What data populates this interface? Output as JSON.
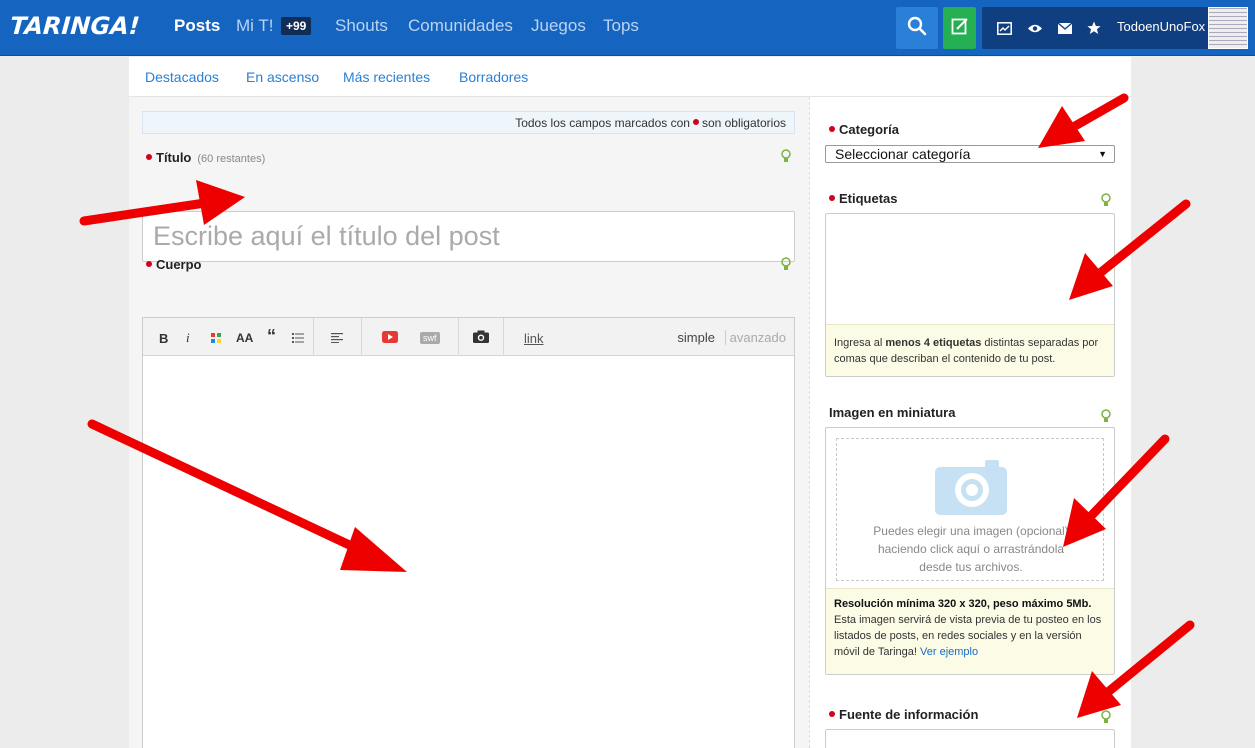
{
  "brand": {
    "logo": "TARINGA!"
  },
  "nav": {
    "items": [
      {
        "label": "Posts"
      },
      {
        "label": "Mi T!"
      },
      {
        "label": "Shouts"
      },
      {
        "label": "Comunidades"
      },
      {
        "label": "Juegos"
      },
      {
        "label": "Tops"
      }
    ],
    "badge": "+99"
  },
  "user": {
    "name": "TodoenUnoFox"
  },
  "subnav": {
    "items": [
      {
        "label": "Destacados"
      },
      {
        "label": "En ascenso"
      },
      {
        "label": "Más recientes"
      },
      {
        "label": "Borradores"
      }
    ]
  },
  "form": {
    "required_note_prefix": "Todos los campos marcados con",
    "required_note_suffix": "son obligatorios",
    "title": {
      "label": "Título",
      "remaining": "(60 restantes)",
      "placeholder": "Escribe aquí el título del post"
    },
    "body": {
      "label": "Cuerpo",
      "toolbar": {
        "bold": "B",
        "italic": "i",
        "size": "AA",
        "quote": "“",
        "swf": "swf",
        "link": "link",
        "mode_simple": "simple",
        "mode_advanced": "avanzado"
      }
    }
  },
  "sidebar": {
    "category": {
      "label": "Categoría",
      "selected": "Seleccionar categoría"
    },
    "tags": {
      "label": "Etiquetas",
      "help_prefix": "Ingresa al",
      "help_bold": "menos 4 etiquetas",
      "help_rest": "distintas separadas por comas que describan el contenido de tu post."
    },
    "thumbnail": {
      "label": "Imagen en miniatura",
      "drop_line1": "Puedes elegir una imagen (opcional)",
      "drop_line2": "haciendo click aquí o arrastrándola",
      "drop_line3": "desde tus archivos.",
      "help_bold": "Resolución mínima 320 x 320, peso máximo 5Mb.",
      "help_rest": "Esta imagen servirá de vista previa de tu posteo en los listados de posts, en redes sociales y en la versión móvil de Taringa!",
      "help_link": "Ver ejemplo"
    },
    "source": {
      "label": "Fuente de información"
    }
  },
  "colors": {
    "header_bg": "#1565c0",
    "accent_blue": "#2a7fd6",
    "post_button": "#24b052",
    "required_dot": "#d0021b",
    "annotation_arrow": "#ee0000"
  }
}
